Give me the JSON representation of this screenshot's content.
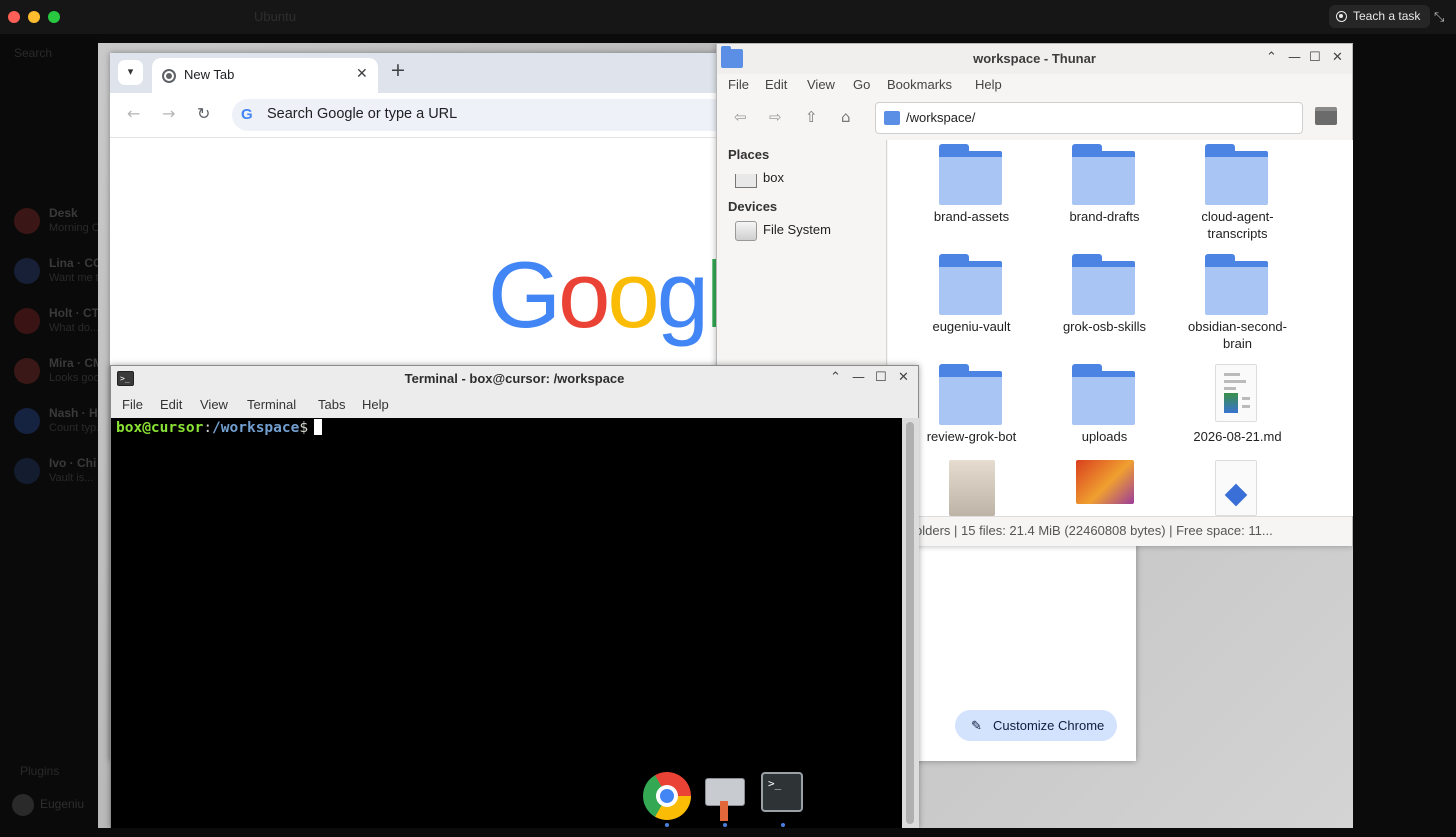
{
  "host": {
    "title": "Ubuntu",
    "teach_label": "Teach a task",
    "sidebar": {
      "search": "Search",
      "items": [
        {
          "name": "Desk",
          "sub": "Morning CI..."
        },
        {
          "name": "Lina · CC",
          "sub": "Want me to..."
        },
        {
          "name": "Holt · CT",
          "sub": "What do..."
        },
        {
          "name": "Mira · CM",
          "sub": "Looks good..."
        },
        {
          "name": "Nash · H",
          "sub": "Count typ..."
        },
        {
          "name": "Ivo · Chi",
          "sub": "Vault is..."
        }
      ],
      "plugins": "Plugins",
      "user": "Eugeniu"
    }
  },
  "chrome": {
    "tab_title": "New Tab",
    "omnibox_placeholder": "Search Google or type a URL",
    "customize_label": "Customize Chrome"
  },
  "thunar": {
    "title": "workspace - Thunar",
    "menu": [
      "File",
      "Edit",
      "View",
      "Go",
      "Bookmarks",
      "Help"
    ],
    "path": "/workspace/",
    "places_heading": "Places",
    "devices_heading": "Devices",
    "places": [
      {
        "label": "box",
        "icon": "home-icon"
      }
    ],
    "devices": [
      {
        "label": "File System",
        "icon": "drive-icon"
      }
    ],
    "files": [
      {
        "label": "brand-assets",
        "type": "folder"
      },
      {
        "label": "brand-drafts",
        "type": "folder"
      },
      {
        "label": "cloud-agent-\ntranscripts",
        "type": "folder"
      },
      {
        "label": "eugeniu-vault",
        "type": "folder"
      },
      {
        "label": "grok-osb-skills",
        "type": "folder"
      },
      {
        "label": "obsidian-second-\nbrain",
        "type": "folder"
      },
      {
        "label": "review-grok-bot",
        "type": "folder"
      },
      {
        "label": "uploads",
        "type": "folder"
      },
      {
        "label": "2026-08-21.md",
        "type": "markdown"
      }
    ],
    "status": "olders  |  15 files: 21.4 MiB (22460808 bytes)  |  Free space: 11..."
  },
  "terminal": {
    "title": "Terminal - box@cursor: /workspace",
    "menu": [
      "File",
      "Edit",
      "View",
      "Terminal",
      "Tabs",
      "Help"
    ],
    "prompt_user": "box@cursor",
    "prompt_path": "/workspace",
    "prompt_symbol": "$"
  },
  "dock": [
    "Google Chrome",
    "File Manager",
    "Terminal"
  ],
  "colors": {
    "chrome_tabstrip": "#dfe3eb",
    "folder_blue": "#4b84e3",
    "prompt_green": "#8ae234",
    "prompt_blue": "#729fcf"
  }
}
